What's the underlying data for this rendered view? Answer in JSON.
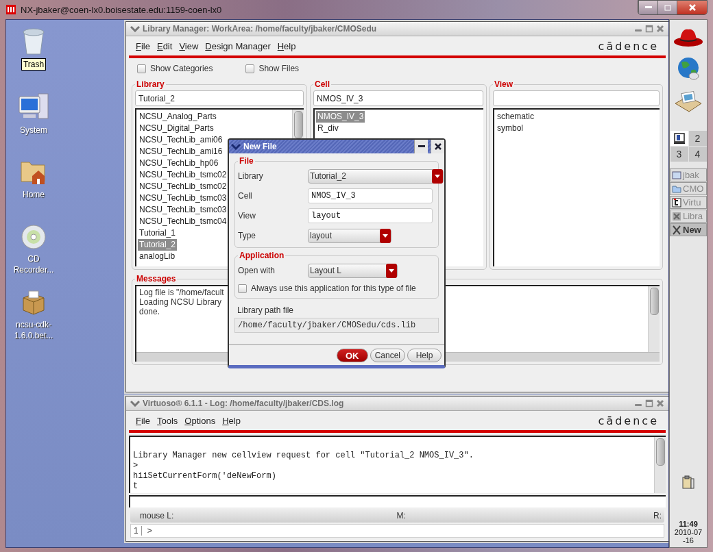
{
  "outer_window": {
    "title": "NX-jbaker@coen-lx0.boisestate.edu:1159-coen-lx0"
  },
  "desktop_icons": [
    {
      "label": "Trash",
      "kind": "trash",
      "selected": true
    },
    {
      "label": "System",
      "kind": "computer",
      "selected": false
    },
    {
      "label": "Home",
      "kind": "home",
      "selected": false
    },
    {
      "label": "CD Recorder...",
      "kind": "cd",
      "selected": false
    },
    {
      "label": "ncsu-cdk-1.6.0.bet...",
      "kind": "package",
      "selected": false
    }
  ],
  "library_manager": {
    "title": "Library Manager: WorkArea: /home/faculty/jbaker/CMOSedu",
    "menu": [
      "File",
      "Edit",
      "View",
      "Design Manager",
      "Help"
    ],
    "logo": "cādence",
    "options": [
      {
        "label": "Show Categories",
        "checked": false
      },
      {
        "label": "Show Files",
        "checked": false
      }
    ],
    "panes": [
      {
        "title": "Library",
        "filter": "Tutorial_2",
        "scrollbar": true,
        "items": [
          {
            "label": "NCSU_Analog_Parts",
            "selected": false
          },
          {
            "label": "NCSU_Digital_Parts",
            "selected": false
          },
          {
            "label": "NCSU_TechLib_ami06",
            "selected": false
          },
          {
            "label": "NCSU_TechLib_ami16",
            "selected": false
          },
          {
            "label": "NCSU_TechLib_hp06",
            "selected": false
          },
          {
            "label": "NCSU_TechLib_tsmc02",
            "selected": false
          },
          {
            "label": "NCSU_TechLib_tsmc02",
            "selected": false
          },
          {
            "label": "NCSU_TechLib_tsmc03",
            "selected": false
          },
          {
            "label": "NCSU_TechLib_tsmc03",
            "selected": false
          },
          {
            "label": "NCSU_TechLib_tsmc04",
            "selected": false
          },
          {
            "label": "Tutorial_1",
            "selected": false
          },
          {
            "label": "Tutorial_2",
            "selected": true
          },
          {
            "label": "analogLib",
            "selected": false
          }
        ]
      },
      {
        "title": "Cell",
        "filter": "NMOS_IV_3",
        "scrollbar": false,
        "items": [
          {
            "label": "NMOS_IV_3",
            "selected": true
          },
          {
            "label": "R_div",
            "selected": false
          }
        ]
      },
      {
        "title": "View",
        "scrollbar": false,
        "items": [
          {
            "label": "schematic",
            "selected": false
          },
          {
            "label": "symbol",
            "selected": false
          }
        ]
      }
    ],
    "messages": {
      "title": "Messages",
      "lines": [
        "Log file is \"/home/facult",
        "Loading NCSU Library",
        "done."
      ]
    }
  },
  "new_file_dialog": {
    "title": "New File",
    "file_section": {
      "title": "File",
      "fields": [
        {
          "label": "Library",
          "kind": "dropdown",
          "value": "Tutorial_2"
        },
        {
          "label": "Cell",
          "kind": "text",
          "value": "NMOS_IV_3"
        },
        {
          "label": "View",
          "kind": "text",
          "value": "layout"
        },
        {
          "label": "Type",
          "kind": "dropdown",
          "value": "layout"
        }
      ]
    },
    "application_section": {
      "title": "Application",
      "open_with_label": "Open with",
      "open_with": "Layout L",
      "always_use": {
        "label": "Always use this application for this type of file",
        "checked": false
      }
    },
    "path_label": "Library path file",
    "path": "/home/faculty/jbaker/CMOSedu/cds.lib",
    "buttons": [
      {
        "label": "OK",
        "kind": "default"
      },
      {
        "label": "Cancel",
        "kind": "normal"
      },
      {
        "label": "Help",
        "kind": "normal"
      }
    ]
  },
  "log_window": {
    "title": "Virtuoso® 6.1.1 - Log: /home/faculty/jbaker/CDS.log",
    "menu": [
      "File",
      "Tools",
      "Options",
      "Help"
    ],
    "logo": "cādence",
    "lines": [
      "Library Manager new cellview request for cell \"Tutorial_2 NMOS_IV_3\".",
      ">",
      "hiiSetCurrentForm('deNewForm)",
      "t"
    ],
    "status": {
      "left": "mouse L:",
      "middle": "M:",
      "right": "R:"
    },
    "prompt": {
      "number": "1",
      "text": ">"
    }
  },
  "side_panel": {
    "launchers": [
      {
        "kind": "hat"
      },
      {
        "kind": "globe"
      },
      {
        "kind": "envelope"
      }
    ],
    "workspaces": [
      {
        "selected": true
      },
      {
        "label": "2",
        "selected": false
      },
      {
        "label": "3",
        "selected": false
      },
      {
        "label": "4",
        "selected": false
      }
    ],
    "tasks": [
      {
        "label": "jbak",
        "kind": "terminal",
        "selected": false
      },
      {
        "label": "CMO",
        "kind": "folder",
        "selected": false
      },
      {
        "label": "Virtu",
        "kind": "cadence",
        "selected": false
      },
      {
        "label": "Libra",
        "kind": "tools",
        "selected": false
      },
      {
        "label": "New",
        "kind": "x",
        "selected": true
      }
    ],
    "clock": {
      "time": "11:49",
      "date": [
        "2010-07",
        "-16"
      ]
    }
  }
}
